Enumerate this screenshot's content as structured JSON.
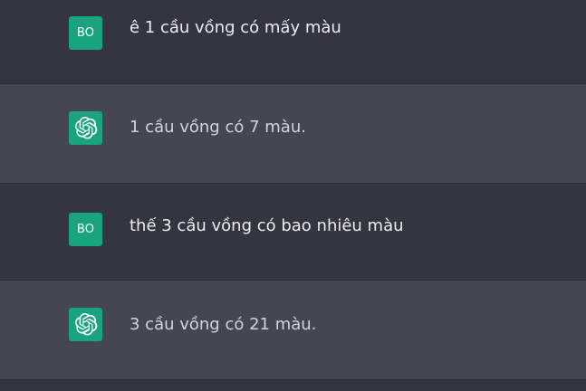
{
  "messages": [
    {
      "role": "user",
      "avatar": "BO",
      "text": "ê 1 cầu vồng có mấy màu"
    },
    {
      "role": "assistant",
      "avatar_icon": "openai-logo-icon",
      "text": "1 cầu vồng có 7 màu."
    },
    {
      "role": "user",
      "avatar": "BO",
      "text": "thế 3 cầu vồng có bao nhiêu màu"
    },
    {
      "role": "assistant",
      "avatar_icon": "openai-logo-icon",
      "text": "3 cầu vồng có 21 màu."
    }
  ],
  "colors": {
    "user_bg": "#343541",
    "assistant_bg": "#444654",
    "avatar_bg": "#19a37f",
    "text": "#ececf1"
  }
}
